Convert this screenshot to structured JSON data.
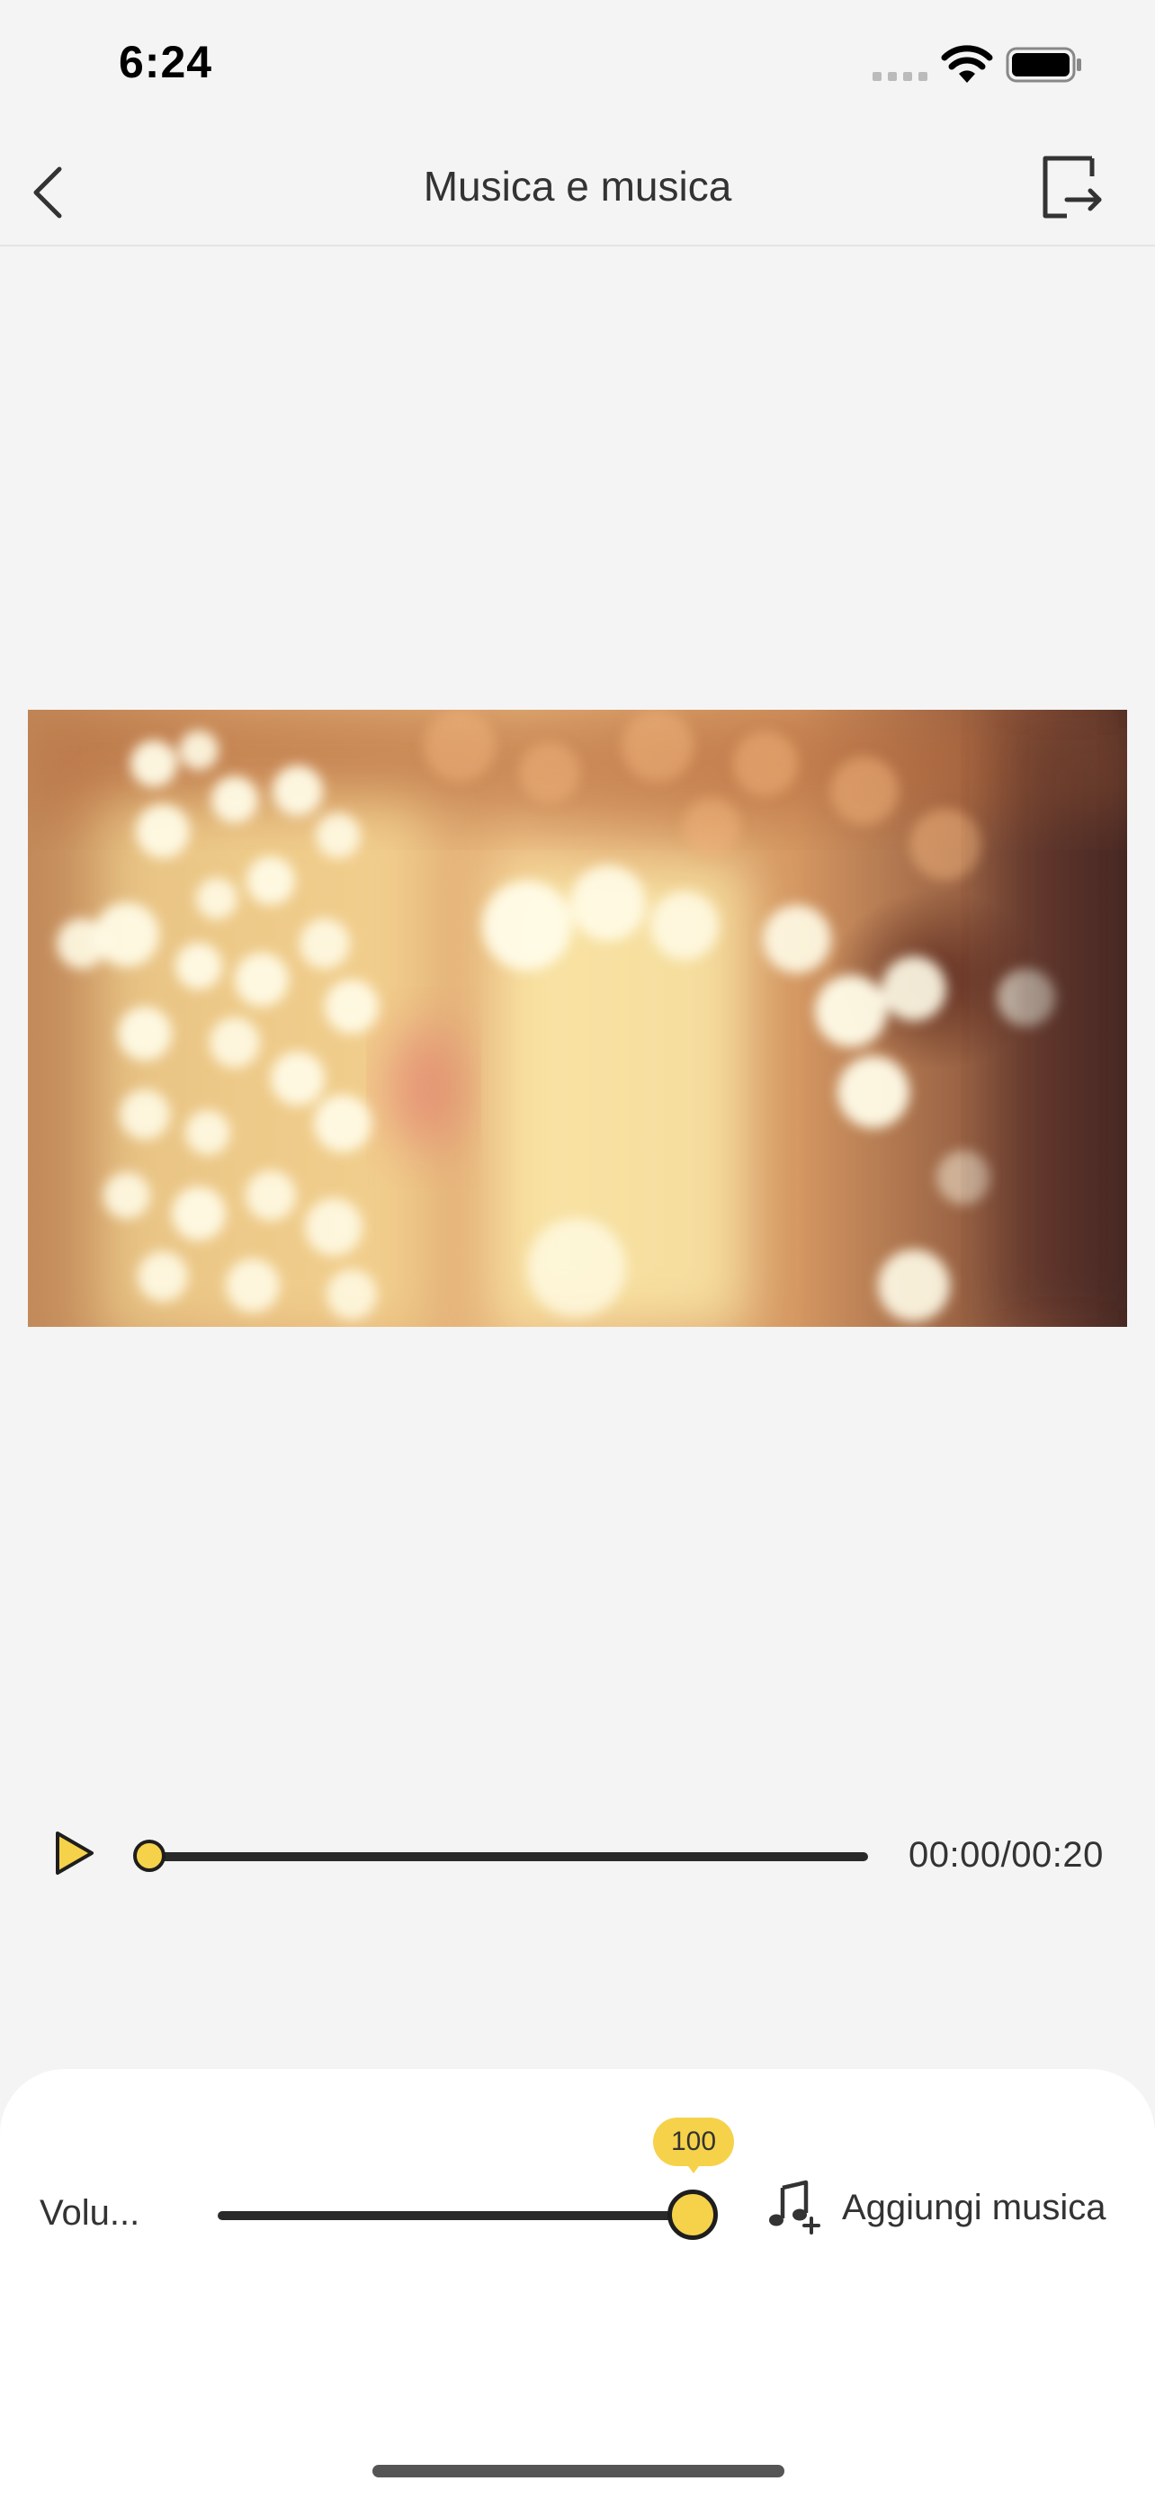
{
  "status_bar": {
    "time": "6:24",
    "icons": [
      "signal-icon",
      "wifi-icon",
      "battery-icon"
    ]
  },
  "nav": {
    "title": "Musica e musica",
    "back_icon": "chevron-left-icon",
    "export_icon": "export-icon"
  },
  "player": {
    "play_icon": "play-icon",
    "time": "00:00/00:20",
    "progress_fraction": 0.0
  },
  "audio": {
    "volume_label": "Volu...",
    "volume_value": "100",
    "add_music_label": "Aggiungi musica",
    "add_music_icon": "music-add-icon"
  },
  "colors": {
    "accent": "#f6d24a",
    "background": "#f4f4f4",
    "panel": "#ffffff",
    "text": "#333333"
  }
}
